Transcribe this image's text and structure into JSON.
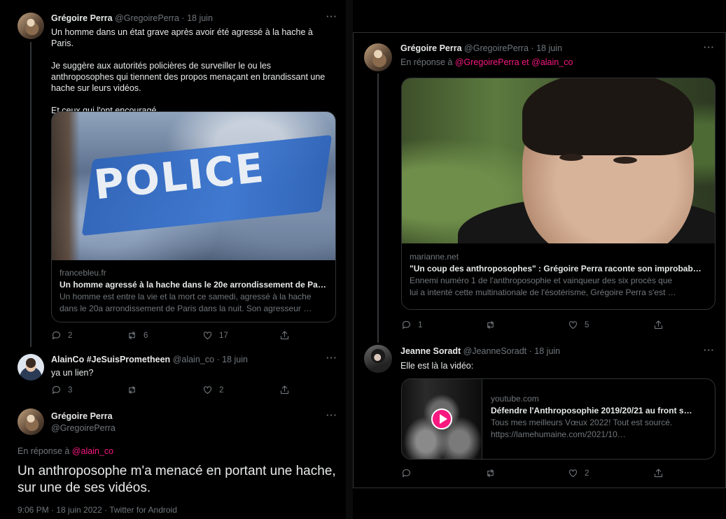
{
  "left": {
    "tweet1": {
      "name": "Grégoire Perra",
      "handle": "@GregoirePerra",
      "date": "18 juin",
      "paragraphs": [
        "Un homme dans un état grave après avoir été agressé à la hache à Paris.",
        "Je suggère aux autorités policières de surveiller le ou les anthroposophes qui tiennent des propos menaçant en brandissant une hache sur leurs vidéos.",
        "Et ceux qui l'ont encouragé."
      ],
      "card": {
        "image_text": "POLICE",
        "domain": "francebleu.fr",
        "title": "Un homme agressé à la hache dans le 20e arrondissement de Paris, s…",
        "desc1": "Un homme est entre la vie et la mort ce samedi, agressé à la hache",
        "desc2": "dans le 20a arrondissement de Paris dans la nuit. Son agresseur …"
      },
      "stats": {
        "replies": "2",
        "retweets": "6",
        "likes": "17"
      }
    },
    "tweet2": {
      "name": "AlainCo #JeSuisPrometheen",
      "handle": "@alain_co",
      "date": "18 juin",
      "text": "ya un lien?",
      "stats": {
        "replies": "3",
        "likes": "2"
      }
    },
    "tweet3": {
      "name": "Grégoire Perra",
      "handle": "@GregoirePerra",
      "reply_prefix": "En réponse à",
      "reply_to": "@alain_co",
      "text": "Un anthroposophe m'a menacé en portant une hache, sur une de ses vidéos.",
      "meta": "9:06 PM · 18 juin 2022 · Twitter for Android"
    }
  },
  "right": {
    "tweet1": {
      "name": "Grégoire Perra",
      "handle": "@GregoirePerra",
      "date": "18 juin",
      "reply_prefix": "En réponse à",
      "reply_to_1": "@GregoirePerra",
      "reply_join": "et",
      "reply_to_2": "@alain_co",
      "card": {
        "domain": "marianne.net",
        "title": "\"Un coup des anthroposophes\" : Grégoire Perra raconte son improbab…",
        "desc1": "Ennemi numéro 1 de l'anthroposophie et vainqueur des six procès que",
        "desc2": "lui a intenté cette multinationale de l'ésotérisme, Grégoire Perra s'est …"
      },
      "stats": {
        "replies": "1",
        "likes": "5"
      }
    },
    "tweet2": {
      "name": "Jeanne Soradt",
      "handle": "@JeanneSoradt",
      "date": "18 juin",
      "text": "Elle est là la vidéo:",
      "card": {
        "domain": "youtube.com",
        "title": "Défendre l'Anthroposophie 2019/20/21 au front s…",
        "desc1": "Tous mes meilleurs Vœux 2022! Tout est sourcé.",
        "desc2": "https://lamehumaine.com/2021/10…"
      },
      "stats": {
        "likes": "2"
      }
    }
  },
  "ui": {
    "more": "···",
    "dot": "·"
  },
  "colors": {
    "background": "#000000",
    "text": "#e7e9ea",
    "muted": "#71767b",
    "accent": "#f91880",
    "border": "#2f3336"
  }
}
